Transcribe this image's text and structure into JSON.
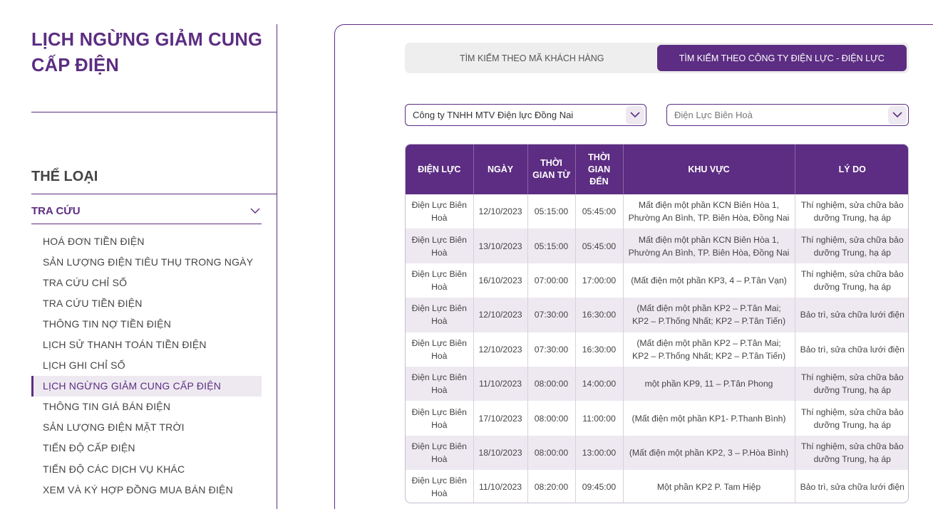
{
  "sidebar": {
    "page_title": "LỊCH NGỪNG GIẢM CUNG CẤP ĐIỆN",
    "category_title": "THỂ LOẠI",
    "group_label": "TRA CỨU",
    "items": [
      {
        "label": "HOÁ ĐƠN TIỀN ĐIỆN"
      },
      {
        "label": "SẢN LƯỢNG ĐIỆN TIÊU THỤ TRONG NGÀY"
      },
      {
        "label": "TRA CỨU CHỈ SỐ"
      },
      {
        "label": "TRA CỨU TIỀN ĐIỆN"
      },
      {
        "label": "THÔNG TIN NỢ TIỀN ĐIỆN"
      },
      {
        "label": "LỊCH SỬ THANH TOÁN TIỀN ĐIỆN"
      },
      {
        "label": "LỊCH GHI CHỈ SỐ"
      },
      {
        "label": "LỊCH NGỪNG GIẢM CUNG CẤP ĐIỆN",
        "active": true
      },
      {
        "label": "THÔNG TIN GIÁ BÁN ĐIỆN"
      },
      {
        "label": "SẢN LƯỢNG ĐIỆN MẶT TRỜI"
      },
      {
        "label": "TIẾN ĐỘ CẤP ĐIỆN"
      },
      {
        "label": "TIẾN ĐỘ CÁC DỊCH VỤ KHÁC"
      },
      {
        "label": "XEM VÀ KÝ HỢP ĐỒNG MUA BÁN ĐIỆN"
      }
    ]
  },
  "tabs": [
    {
      "label": "TÌM KIẾM THEO MÃ KHÁCH HÀNG",
      "active": false
    },
    {
      "label": "TÌM KIẾM THEO CÔNG TY ĐIỆN LỰC - ĐIỆN LỰC",
      "active": true
    }
  ],
  "filters": {
    "company": "Công ty TNHH MTV Điện lực Đồng Nai",
    "branch": "Điện Lực Biên Hoà"
  },
  "table": {
    "headers": [
      "ĐIỆN LỰC",
      "NGÀY",
      "THỜI GIAN TỪ",
      "THỜI GIAN ĐẾN",
      "KHU VỰC",
      "LÝ DO"
    ],
    "rows": [
      [
        "Điện Lực Biên Hoà",
        "12/10/2023",
        "05:15:00",
        "05:45:00",
        "Mất điện một phần KCN Biên Hòa 1, Phường An Bình, TP. Biên Hòa, Đồng Nai",
        "Thí nghiệm, sửa chữa bảo dưỡng Trung, hạ áp"
      ],
      [
        "Điện Lực Biên Hoà",
        "13/10/2023",
        "05:15:00",
        "05:45:00",
        "Mất điện một phần KCN Biên Hòa 1, Phường An Bình, TP. Biên Hòa, Đồng Nai",
        "Thí nghiệm, sửa chữa bảo dưỡng Trung, hạ áp"
      ],
      [
        "Điện Lực Biên Hoà",
        "16/10/2023",
        "07:00:00",
        "17:00:00",
        "(Mất điện một phần KP3, 4 – P.Tân Vạn)",
        "Thí nghiệm, sửa chữa bảo dưỡng Trung, hạ áp"
      ],
      [
        "Điện Lực Biên Hoà",
        "12/10/2023",
        "07:30:00",
        "16:30:00",
        "(Mất điện một phần KP2 – P.Tân Mai; KP2 – P.Thống Nhất; KP2 – P.Tân Tiến)",
        "Bảo trì, sửa chữa lưới điện"
      ],
      [
        "Điện Lực Biên Hoà",
        "12/10/2023",
        "07:30:00",
        "16:30:00",
        "(Mất điện một phần KP2 – P.Tân Mai; KP2 – P.Thống Nhất; KP2 – P.Tân Tiến)",
        "Bảo trì, sửa chữa lưới điện"
      ],
      [
        "Điện Lực Biên Hoà",
        "11/10/2023",
        "08:00:00",
        "14:00:00",
        "một phần KP9, 11 – P.Tân Phong",
        "Thí nghiệm, sửa chữa bảo dưỡng Trung, hạ áp"
      ],
      [
        "Điện Lực Biên Hoà",
        "17/10/2023",
        "08:00:00",
        "11:00:00",
        "(Mất điện một phần KP1- P.Thanh Bình)",
        "Thí nghiệm, sửa chữa bảo dưỡng Trung, hạ áp"
      ],
      [
        "Điện Lực Biên Hoà",
        "18/10/2023",
        "08:00:00",
        "13:00:00",
        "(Mất điện một phần KP2, 3 – P.Hòa Bình)",
        "Thí nghiệm, sửa chữa bảo dưỡng Trung, hạ áp"
      ],
      [
        "Điện Lực Biên Hoà",
        "11/10/2023",
        "08:20:00",
        "09:45:00",
        "Một phần KP2 P. Tam Hiệp",
        "Bảo trì, sửa chữa lưới điện"
      ]
    ]
  },
  "colors": {
    "brand": "#5c2d82",
    "row_alt": "#eee9f1"
  }
}
